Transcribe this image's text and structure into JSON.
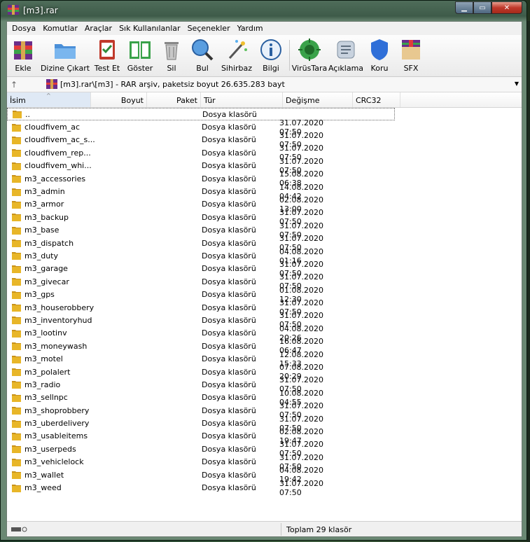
{
  "window": {
    "title": "[m3].rar"
  },
  "menu": [
    "Dosya",
    "Komutlar",
    "Araçlar",
    "Sık Kullanılanlar",
    "Seçenekler",
    "Yardım"
  ],
  "toolbar": [
    {
      "label": "Ekle",
      "icon": "add-archive-icon"
    },
    {
      "label": "Dizine Çıkart",
      "icon": "extract-to-icon"
    },
    {
      "label": "Test Et",
      "icon": "test-icon"
    },
    {
      "label": "Göster",
      "icon": "view-icon"
    },
    {
      "label": "Sil",
      "icon": "delete-icon"
    },
    {
      "label": "Bul",
      "icon": "find-icon"
    },
    {
      "label": "Sihirbaz",
      "icon": "wizard-icon"
    },
    {
      "label": "Bilgi",
      "icon": "info-icon"
    },
    {
      "label": "VirüsTara",
      "icon": "virus-scan-icon"
    },
    {
      "label": "Açıklama",
      "icon": "comment-icon"
    },
    {
      "label": "Koru",
      "icon": "protect-icon"
    },
    {
      "label": "SFX",
      "icon": "sfx-icon"
    }
  ],
  "address": {
    "text": "[m3].rar\\[m3] - RAR arşiv, paketsiz boyut 26.635.283 bayt"
  },
  "columns": {
    "name": "İsim",
    "size": "Boyut",
    "packed": "Paket",
    "type": "Tür",
    "modified": "Değişme",
    "crc": "CRC32"
  },
  "rows": [
    {
      "name": "..",
      "type": "Dosya klasörü",
      "modified": ""
    },
    {
      "name": "cloudfivem_ac",
      "type": "Dosya klasörü",
      "modified": "31.07.2020 07:50"
    },
    {
      "name": "cloudfivem_ac_s...",
      "type": "Dosya klasörü",
      "modified": "31.07.2020 07:50"
    },
    {
      "name": "cloudfivem_rep...",
      "type": "Dosya klasörü",
      "modified": "31.07.2020 07:50"
    },
    {
      "name": "cloudfivem_whi...",
      "type": "Dosya klasörü",
      "modified": "31.07.2020 07:50"
    },
    {
      "name": "m3_accessories",
      "type": "Dosya klasörü",
      "modified": "15.08.2020 06:38"
    },
    {
      "name": "m3_admin",
      "type": "Dosya klasörü",
      "modified": "14.08.2020 04:42"
    },
    {
      "name": "m3_armor",
      "type": "Dosya klasörü",
      "modified": "02.08.2020 13:00"
    },
    {
      "name": "m3_backup",
      "type": "Dosya klasörü",
      "modified": "31.07.2020 07:50"
    },
    {
      "name": "m3_base",
      "type": "Dosya klasörü",
      "modified": "31.07.2020 07:50"
    },
    {
      "name": "m3_dispatch",
      "type": "Dosya klasörü",
      "modified": "31.07.2020 07:50"
    },
    {
      "name": "m3_duty",
      "type": "Dosya klasörü",
      "modified": "04.08.2020 01:16"
    },
    {
      "name": "m3_garage",
      "type": "Dosya klasörü",
      "modified": "31.07.2020 07:50"
    },
    {
      "name": "m3_givecar",
      "type": "Dosya klasörü",
      "modified": "31.07.2020 07:50"
    },
    {
      "name": "m3_gps",
      "type": "Dosya klasörü",
      "modified": "01.08.2020 12:30"
    },
    {
      "name": "m3_houserobbery",
      "type": "Dosya klasörü",
      "modified": "31.07.2020 07:50"
    },
    {
      "name": "m3_inventoryhud",
      "type": "Dosya klasörü",
      "modified": "31.07.2020 07:50"
    },
    {
      "name": "m3_lootinv",
      "type": "Dosya klasörü",
      "modified": "04.08.2020 20:26"
    },
    {
      "name": "m3_moneywash",
      "type": "Dosya klasörü",
      "modified": "16.08.2020 06:47"
    },
    {
      "name": "m3_motel",
      "type": "Dosya klasörü",
      "modified": "12.08.2020 15:33"
    },
    {
      "name": "m3_polalert",
      "type": "Dosya klasörü",
      "modified": "07.08.2020 20:29"
    },
    {
      "name": "m3_radio",
      "type": "Dosya klasörü",
      "modified": "31.07.2020 07:50"
    },
    {
      "name": "m3_sellnpc",
      "type": "Dosya klasörü",
      "modified": "10.08.2020 04:55"
    },
    {
      "name": "m3_shoprobbery",
      "type": "Dosya klasörü",
      "modified": "31.07.2020 07:50"
    },
    {
      "name": "m3_uberdelivery",
      "type": "Dosya klasörü",
      "modified": "31.07.2020 07:50"
    },
    {
      "name": "m3_usableitems",
      "type": "Dosya klasörü",
      "modified": "02.08.2020 19:47"
    },
    {
      "name": "m3_userpeds",
      "type": "Dosya klasörü",
      "modified": "31.07.2020 07:50"
    },
    {
      "name": "m3_vehiclelock",
      "type": "Dosya klasörü",
      "modified": "31.07.2020 07:50"
    },
    {
      "name": "m3_wallet",
      "type": "Dosya klasörü",
      "modified": "04.08.2020 19:42"
    },
    {
      "name": "m3_weed",
      "type": "Dosya klasörü",
      "modified": "31.07.2020 07:50"
    }
  ],
  "status": {
    "total": "Toplam 29 klasör"
  },
  "colors": {
    "folder": "#e8b628",
    "folder_dark": "#c8921a",
    "accent": "#3e5b49"
  }
}
